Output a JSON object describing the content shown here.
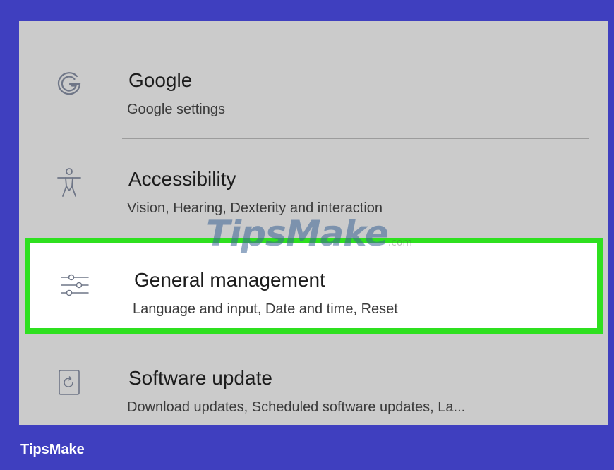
{
  "settings_items": [
    {
      "icon": "google-g-icon",
      "title": "Google",
      "subtitle": "Google settings"
    },
    {
      "icon": "accessibility-icon",
      "title": "Accessibility",
      "subtitle": "Vision, Hearing, Dexterity and interaction"
    },
    {
      "icon": "sliders-icon",
      "title": "General management",
      "subtitle": "Language and input, Date and time, Reset",
      "highlighted": true
    },
    {
      "icon": "software-update-icon",
      "title": "Software update",
      "subtitle": "Download updates, Scheduled software updates, La..."
    }
  ],
  "watermark": {
    "text": "TipsMake",
    "suffix": ".com"
  },
  "brand_label": "TipsMake",
  "colors": {
    "frame": "#3f3fbf",
    "highlight_border": "#2ee01f",
    "panel": "#cbcbcb",
    "icon": "#6f7687"
  }
}
